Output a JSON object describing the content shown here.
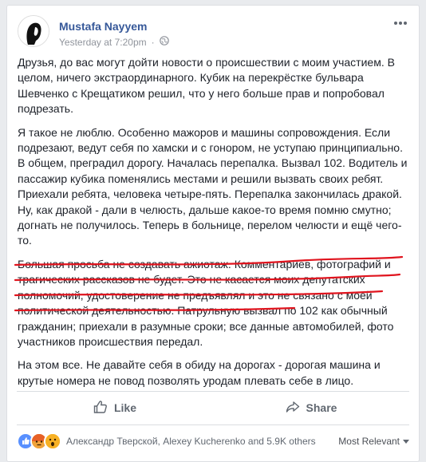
{
  "post": {
    "author": "Mustafa Nayyem",
    "timestamp": "Yesterday at 7:20pm",
    "audience_icon": "globe-icon",
    "paragraphs": [
      "Друзья, до вас могут дойти новости о происшествии с моим участием. В целом, ничего экстраординарного. Кубик на перекрёстке бульвара Шевченко с Крещатиком решил, что у него больше прав и попробовал подрезать.",
      "Я такое не люблю. Особенно мажоров и машины сопровождения. Если подрезают, ведут себя по хамски и с гонором, не уступаю принципиально. В общем, преградил дорогу. Началась перепалка. Вызвал 102. Водитель и пассажир кубика поменялись местами и решили вызвать своих ребят. Приехали ребята, человека четыре-пять. Перепалка закончилась дракой. Ну, как дракой - дали в челюсть, дальше какое-то время помню смутно; догнать не получилось. Теперь в больнице, перелом челюсти и ещё чего-то.",
      "Большая просьба не создавать ажиотаж. Комментариев, фотографий и трагических рассказов не будет. Это не касается моих депутатских полномочий, удостоверение не предъявлял и это не связано с моей политической деятельностью. Патрульную вызвал по 102 как обычный гражданин; приехали в разумные сроки; все данные автомобилей, фото участников происшествия передал.",
      "На этом все. Не давайте себя в обиду на дорогах - дорогая машина и крутые номера не повод позволять уродам плевать себе в лицо."
    ]
  },
  "actions": {
    "like_label": "Like",
    "share_label": "Share"
  },
  "reactions": {
    "summary": "Александр Тверской, Alexey Kucherenko and 5.9K others",
    "sort_label": "Most Relevant",
    "colors": {
      "like": "#5890ff",
      "angry": "#e9710f",
      "wow": "#f7b125"
    }
  },
  "colors": {
    "link": "#365899",
    "underline": "#e0141e"
  }
}
